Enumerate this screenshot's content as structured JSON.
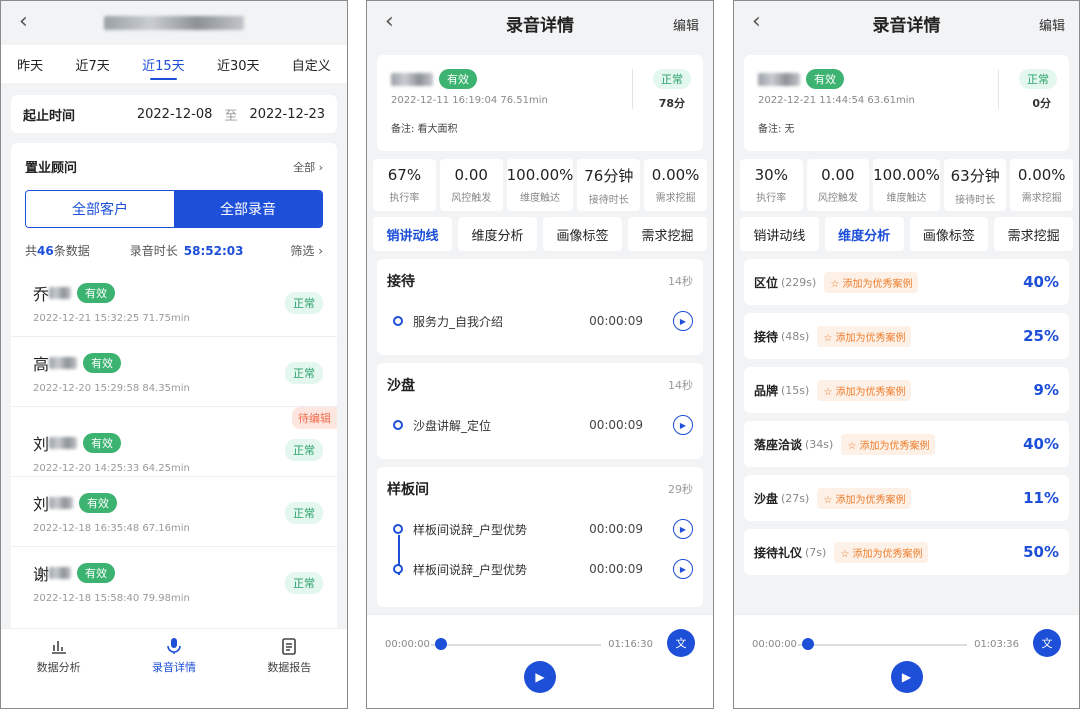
{
  "p1": {
    "date_tabs": [
      "昨天",
      "近7天",
      "近15天",
      "近30天",
      "自定义"
    ],
    "active_tab": 2,
    "range_label": "起止时间",
    "start": "2022-12-08",
    "range_sep": "至",
    "end": "2022-12-23",
    "consultant_label": "置业顾问",
    "all_label": "全部",
    "seg_left": "全部客户",
    "seg_right": "全部录音",
    "summary_prefix": "共",
    "count": "46",
    "summary_suffix": "条数据",
    "duration_label": "录音时长",
    "duration": "58:52:03",
    "filter_label": "筛选",
    "records": [
      {
        "initial": "乔",
        "badge": "有效",
        "sub": "2022-12-21 15:32:25 71.75min",
        "status": "正常",
        "pending": ""
      },
      {
        "initial": "高",
        "badge": "有效",
        "sub": "2022-12-20 15:29:58 84.35min",
        "status": "正常",
        "pending": ""
      },
      {
        "initial": "刘",
        "badge": "有效",
        "sub": "2022-12-20 14:25:33 64.25min",
        "status": "正常",
        "pending": "待编辑"
      },
      {
        "initial": "刘",
        "badge": "有效",
        "sub": "2022-12-18 16:35:48 67.16min",
        "status": "正常",
        "pending": ""
      },
      {
        "initial": "谢",
        "badge": "有效",
        "sub": "2022-12-18 15:58:40 79.98min",
        "status": "正常",
        "pending": ""
      }
    ],
    "nav": [
      "数据分析",
      "录音详情",
      "数据报告"
    ]
  },
  "p2": {
    "title": "录音详情",
    "edit": "编辑",
    "badge": "有效",
    "meta": "2022-12-11 16:19:04 76.51min",
    "note": "备注: 看大面积",
    "status": "正常",
    "score": "78分",
    "stats": [
      {
        "v": "67%",
        "l": "执行率"
      },
      {
        "v": "0.00",
        "l": "风控触发"
      },
      {
        "v": "100.00%",
        "l": "维度触达"
      },
      {
        "v": "76分钟",
        "l": "接待时长"
      },
      {
        "v": "0.00%",
        "l": "需求挖掘"
      }
    ],
    "tabs": [
      "销讲动线",
      "维度分析",
      "画像标签",
      "需求挖掘"
    ],
    "sections": [
      {
        "title": "接待",
        "dur": "14秒",
        "items": [
          {
            "name": "服务力_自我介绍",
            "time": "00:00:09"
          }
        ]
      },
      {
        "title": "沙盘",
        "dur": "14秒",
        "items": [
          {
            "name": "沙盘讲解_定位",
            "time": "00:00:09"
          }
        ]
      },
      {
        "title": "样板间",
        "dur": "29秒",
        "items": [
          {
            "name": "样板间说辞_户型优势",
            "time": "00:00:09"
          },
          {
            "name": "样板间说辞_户型优势",
            "time": "00:00:09"
          }
        ]
      }
    ],
    "player": {
      "start": "00:00:00",
      "end": "01:16:30",
      "text_btn": "文"
    }
  },
  "p3": {
    "title": "录音详情",
    "edit": "编辑",
    "badge": "有效",
    "meta": "2022-12-21 11:44:54 63.61min",
    "note": "备注: 无",
    "status": "正常",
    "score": "0分",
    "stats": [
      {
        "v": "30%",
        "l": "执行率"
      },
      {
        "v": "0.00",
        "l": "风控触发"
      },
      {
        "v": "100.00%",
        "l": "维度触达"
      },
      {
        "v": "63分钟",
        "l": "接待时长"
      },
      {
        "v": "0.00%",
        "l": "需求挖掘"
      }
    ],
    "tabs": [
      "销讲动线",
      "维度分析",
      "画像标签",
      "需求挖掘"
    ],
    "dimensions": [
      {
        "name": "区位",
        "sec": "(229s)",
        "action": "添加为优秀案例",
        "pct": "40%"
      },
      {
        "name": "接待",
        "sec": "(48s)",
        "action": "添加为优秀案例",
        "pct": "25%"
      },
      {
        "name": "品牌",
        "sec": "(15s)",
        "action": "添加为优秀案例",
        "pct": "9%"
      },
      {
        "name": "落座洽谈",
        "sec": "(34s)",
        "action": "添加为优秀案例",
        "pct": "40%"
      },
      {
        "name": "沙盘",
        "sec": "(27s)",
        "action": "添加为优秀案例",
        "pct": "11%"
      },
      {
        "name": "接待礼仪",
        "sec": "(7s)",
        "action": "添加为优秀案例",
        "pct": "50%"
      }
    ],
    "player": {
      "start": "00:00:00",
      "end": "01:03:36",
      "text_btn": "文"
    }
  },
  "colors": {
    "primary": "#1d4fd8",
    "valid": "#3cb371",
    "normal_bg": "#e4f7ee",
    "normal_fg": "#2aa36b",
    "accent_orange": "#ee7d2c"
  },
  "icons": [
    "back-arrow-icon",
    "chevron-right-icon",
    "bar-chart-icon",
    "microphone-icon",
    "clipboard-icon",
    "play-icon",
    "star-outline-icon"
  ]
}
